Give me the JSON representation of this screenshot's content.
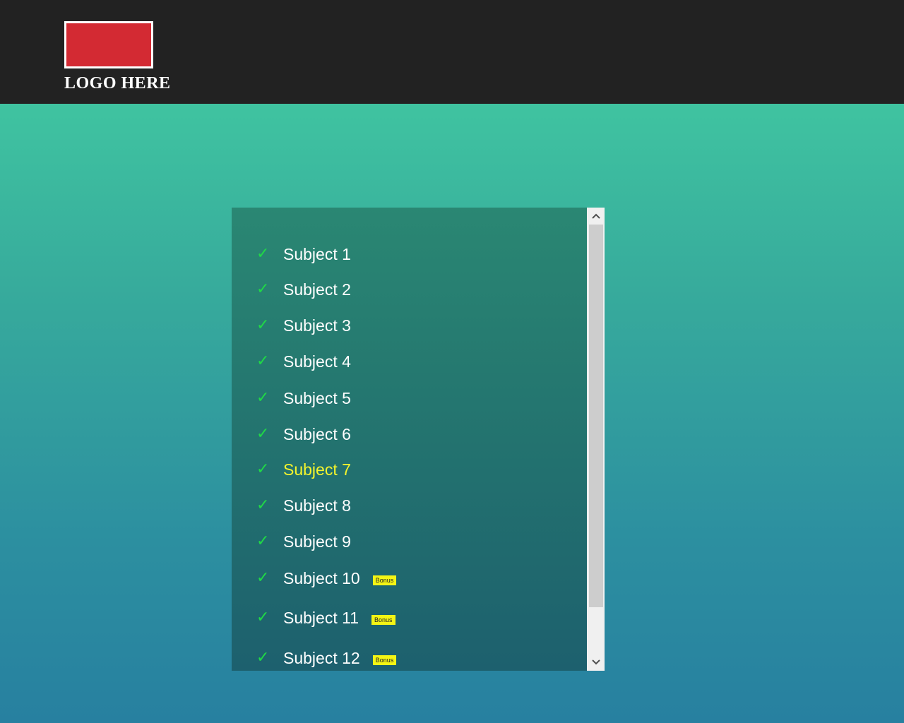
{
  "header": {
    "logo_text": "LOGO HERE",
    "logo_color": "#d32a33"
  },
  "list": {
    "check_icon": "✓",
    "items": [
      {
        "label": "Subject 1"
      },
      {
        "label": "Subject 2"
      },
      {
        "label": "Subject 3"
      },
      {
        "label": "Subject 4"
      },
      {
        "label": "Subject 5"
      },
      {
        "label": "Subject 6"
      },
      {
        "label": "Subject 7",
        "active": true
      },
      {
        "label": "Subject 8"
      },
      {
        "label": "Subject 9"
      },
      {
        "label": "Subject 10",
        "badge": "Bonus"
      },
      {
        "label": "Subject 11",
        "badge": "Bonus"
      },
      {
        "label": "Subject 12",
        "badge": "Bonus"
      }
    ]
  },
  "scrollbar": {
    "up_icon": "chevron-up-icon",
    "down_icon": "chevron-down-icon"
  },
  "colors": {
    "check": "#20d846",
    "active_item": "#f5f52c",
    "badge": "#f5f514"
  }
}
